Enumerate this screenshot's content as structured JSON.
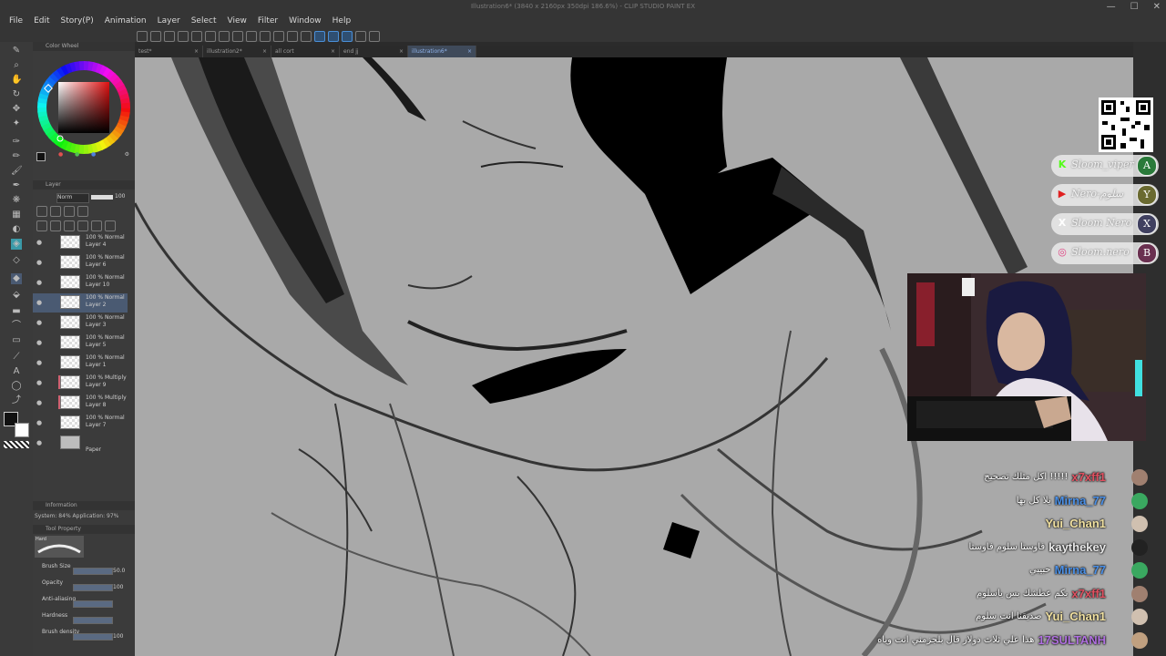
{
  "window": {
    "title": "Illustration6* (3840 x 2160px 350dpi 186.6%) - CLIP STUDIO PAINT EX"
  },
  "menu": [
    "File",
    "Edit",
    "Story(P)",
    "Animation",
    "Layer",
    "Select",
    "View",
    "Filter",
    "Window",
    "Help"
  ],
  "tabs": [
    {
      "label": "test*",
      "active": false
    },
    {
      "label": "illustration2*",
      "active": false
    },
    {
      "label": "all cort",
      "active": false
    },
    {
      "label": "end jj",
      "active": false
    },
    {
      "label": "illustration6*",
      "active": true
    }
  ],
  "panels": {
    "color_wheel": "Color Wheel",
    "layer": "Layer",
    "blend_mode": "Norm",
    "opacity": "100",
    "information": "Information",
    "info_text": "System: 84%   Application: 97%",
    "tool_property": "Tool Property",
    "brush_name": "Hard"
  },
  "layers": [
    {
      "pct": "100 %",
      "mode": "Normal",
      "name": "Layer 4",
      "selected": false,
      "red": false
    },
    {
      "pct": "100 %",
      "mode": "Normal",
      "name": "Layer 6",
      "selected": false,
      "red": false
    },
    {
      "pct": "100 %",
      "mode": "Normal",
      "name": "Layer 10",
      "selected": false,
      "red": false
    },
    {
      "pct": "100 %",
      "mode": "Normal",
      "name": "Layer 2",
      "selected": true,
      "red": false
    },
    {
      "pct": "100 %",
      "mode": "Normal",
      "name": "Layer 3",
      "selected": false,
      "red": false
    },
    {
      "pct": "100 %",
      "mode": "Normal",
      "name": "Layer 5",
      "selected": false,
      "red": false
    },
    {
      "pct": "100 %",
      "mode": "Normal",
      "name": "Layer 1",
      "selected": false,
      "red": false
    },
    {
      "pct": "100 %",
      "mode": "Multiply",
      "name": "Layer 9",
      "selected": false,
      "red": true
    },
    {
      "pct": "100 %",
      "mode": "Multiply",
      "name": "Layer 8",
      "selected": false,
      "red": true
    },
    {
      "pct": "100 %",
      "mode": "Normal",
      "name": "Layer 7",
      "selected": false,
      "red": false
    },
    {
      "pct": "",
      "mode": "",
      "name": "Paper",
      "selected": false,
      "red": false
    }
  ],
  "tool_properties": [
    {
      "label": "Brush Size",
      "value": "50.0"
    },
    {
      "label": "Opacity",
      "value": "100"
    },
    {
      "label": "Anti-aliasing",
      "value": ""
    },
    {
      "label": "Hardness",
      "value": ""
    },
    {
      "label": "Brush density",
      "value": "100"
    }
  ],
  "socials": [
    {
      "platform": "kick",
      "icon": "K",
      "handle": "Sloom_viper",
      "letter": "A",
      "color": "#53fc18"
    },
    {
      "platform": "youtube",
      "icon": "▶",
      "handle": "Nero-سلوم",
      "letter": "Y",
      "color": "#e02020"
    },
    {
      "platform": "x",
      "icon": "X",
      "handle": "Sloom Nero",
      "letter": "X",
      "color": "#ffffff"
    },
    {
      "platform": "instagram",
      "icon": "◎",
      "handle": "Sloom.nero",
      "letter": "B",
      "color": "#e04080"
    }
  ],
  "chat": [
    {
      "name": "x7xff1",
      "text": "!!!!! اكل مثلك تصحيح",
      "color": "#e05060",
      "avatar": "#a08070"
    },
    {
      "name": "Mirna_77",
      "text": "يلا كل بها",
      "color": "#4a90e8",
      "avatar": "#3aa860"
    },
    {
      "name": "Yui_Chan1",
      "text": "",
      "color": "#f0e0a0",
      "avatar": "#d0c0b0"
    },
    {
      "name": "kaythekey",
      "text": "فاوستا سلوم فاوستا",
      "color": "#e8e8e8",
      "avatar": "#222222"
    },
    {
      "name": "Mirna_77",
      "text": "حبيبي",
      "color": "#4a90e8",
      "avatar": "#3aa860"
    },
    {
      "name": "x7xff1",
      "text": "بكم عطشك بس ياسلوم",
      "color": "#e05060",
      "avatar": "#a08070"
    },
    {
      "name": "Yui_Chan1",
      "text": "صديقنا انت سلوم",
      "color": "#f0e0a0",
      "avatar": "#d0c0b0"
    },
    {
      "name": "17SULTANH",
      "text": "هذا علي ثلاث دولار قال بلجزمني انت وياه",
      "color": "#b070e0",
      "avatar": "#c0a080"
    }
  ]
}
